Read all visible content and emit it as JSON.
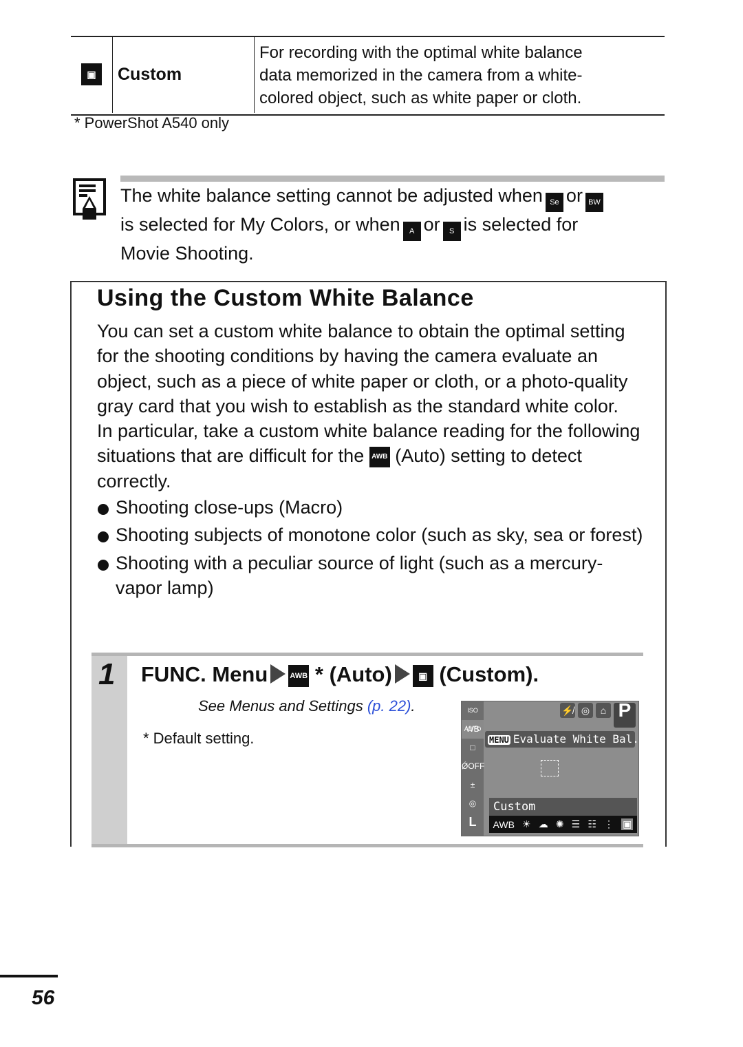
{
  "wb_table": {
    "row": {
      "icon": "custom-wb-icon",
      "name": "Custom",
      "description_lines": [
        "For recording with the optimal white balance",
        "data memorized in the camera from a white-",
        "colored object, such as white paper or cloth."
      ]
    },
    "footnote": "* PowerShot A540 only"
  },
  "note": {
    "icon": "memo-pencil-icon",
    "line1_a": "The white balance setting cannot be adjusted when",
    "icon_sepia": "Se",
    "or1": "or",
    "icon_bw": "BW",
    "line2_a": "is selected for My Colors, or when",
    "icon_movie_a": "A",
    "or2": "or",
    "icon_movie_s": "S",
    "line2_b": "is selected for",
    "line3": "Movie Shooting."
  },
  "section": {
    "title": "Using the Custom White Balance",
    "paragraph1": "You can set a custom white balance to obtain the optimal setting for the shooting conditions by having the camera evaluate an object, such as a piece of white paper or cloth, or a photo-quality gray card that you wish to establish as the standard white color.",
    "paragraph2_a": "In particular, take a custom white balance reading for the following situations that are difficult for the",
    "awb_icon": "AWB",
    "paragraph2_b": "(Auto) setting to detect correctly.",
    "bullets": [
      "Shooting close-ups (Macro)",
      "Shooting subjects of monotone color (such as sky, sea or forest)",
      "Shooting with a peculiar source of light (such as a mercury-vapor lamp)"
    ]
  },
  "step": {
    "number": "1",
    "title_a": "FUNC. Menu",
    "awb_icon": "AWB",
    "title_b": "* (Auto)",
    "title_c": "(Custom).",
    "see_ref_text": "See Menus and Settings ",
    "see_ref_link": "(p. 22)",
    "see_ref_end": ".",
    "default_note": "* Default setting."
  },
  "camera_screen": {
    "side_icons": [
      "ISO AUTO",
      "WB",
      "□",
      "ǾOFF",
      "±",
      "◎",
      "L"
    ],
    "top_icons": [
      "⚡̸",
      "◎",
      "⌂",
      "P"
    ],
    "menu_key": "MENU",
    "menu_text": "Evaluate White Bal.",
    "selected_label": "Custom",
    "wb_options": [
      "AWB",
      "☀",
      "☁",
      "✺",
      "☰",
      "☷",
      "⋮",
      "▣"
    ]
  },
  "page_number": "56"
}
